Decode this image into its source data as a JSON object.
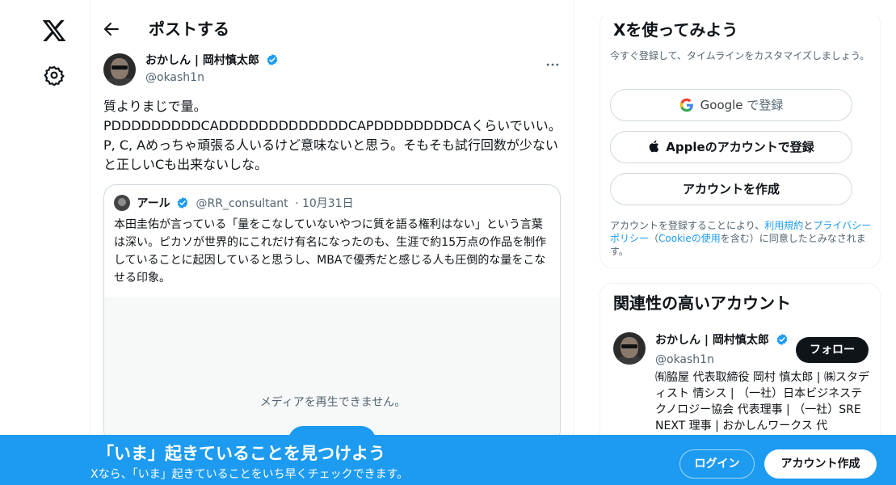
{
  "nav": {
    "logo_icon": "x-logo-icon",
    "settings_icon": "gear-icon"
  },
  "header": {
    "title": "ポストする",
    "back_icon": "arrow-left-icon"
  },
  "post": {
    "author_name": "おかしん | 岡村慎太郎",
    "author_handle": "@okash1n",
    "verified": true,
    "text": "質よりまじで量。\nPDDDDDDDDDCADDDDDDDDDDDDDCAPDDDDDDDDCAくらいでいい。P, C, Aめっちゃ頑張る人いるけど意味ないと思う。そもそも試行回数が少ないと正しいCも出来ないしな。",
    "quote": {
      "name": "アール",
      "handle": "@RR_consultant",
      "date": "· 10月31日",
      "text": "本田圭佑が言っている「量をこなしていないやつに質を語る権利はない」という言葉は深い。ピカソが世界的にこれだけ有名になったのも、生涯で約15万点の作品を制作していることに起因していると思うし、MBAで優秀だと感じる人も圧倒的な量をこなせる印象。",
      "media_message": "メディアを再生できません。"
    }
  },
  "signup_card": {
    "title": "Xを使ってみよう",
    "subtitle": "今すぐ登録して、タイムラインをカスタマイズしましょう。",
    "google_label": "Google",
    "google_suffix": "で登録",
    "apple_label": "Appleのアカウントで登録",
    "create_label": "アカウントを作成",
    "legal_pre": "アカウントを登録することにより、",
    "legal_terms": "利用規約",
    "legal_and": "と",
    "legal_privacy": "プライバシーポリシー",
    "legal_paren_open": "（",
    "legal_cookie": "Cookieの使用",
    "legal_post": "を含む）に同意したとみなされます。"
  },
  "related": {
    "title": "関連性の高いアカウント",
    "name": "おかしん | 岡村慎太郎",
    "handle": "@okash1n",
    "follow_label": "フォロー",
    "bio": "㈲脇屋 代表取締役 岡村 慎太郎 | ㈱スタディスト 情シス | （一社）日本ビジネステクノロジー協会 代表理事 | （一社）SRE NEXT 理事 | おかしんワークス 代"
  },
  "banner": {
    "title": "「いま」起きていることを見つけよう",
    "subtitle": "Xなら、「いま」起きていることをいち早くチェックできます。",
    "login_label": "ログイン",
    "signup_label": "アカウント作成"
  },
  "colors": {
    "accent": "#1d9bf0",
    "text": "#0f1419",
    "muted": "#536471"
  }
}
